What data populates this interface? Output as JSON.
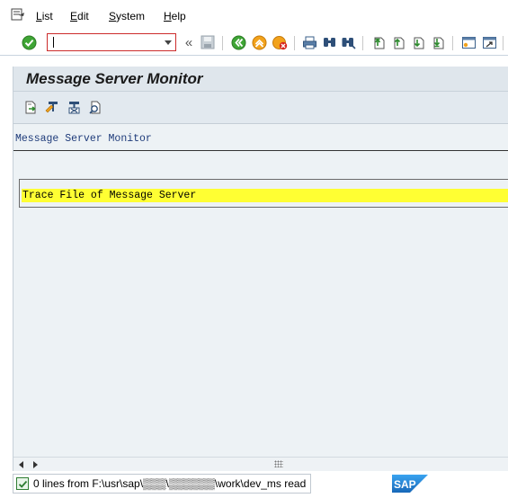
{
  "menubar": {
    "items": [
      {
        "label": "List",
        "key": "L",
        "rest": "ist"
      },
      {
        "label": "Edit",
        "key": "E",
        "rest": "dit"
      },
      {
        "label": "System",
        "key": "S",
        "rest": "ystem"
      },
      {
        "label": "Help",
        "key": "H",
        "rest": "elp"
      }
    ]
  },
  "toolbar": {
    "command_field_value": "",
    "icons": [
      "enter-icon",
      "back-icon",
      "save-icon",
      "back-green-icon",
      "exit-icon",
      "cancel-icon",
      "print-icon",
      "find-icon",
      "find-next-icon",
      "first-page-icon",
      "previous-page-icon",
      "next-page-icon",
      "last-page-icon",
      "create-session-icon",
      "shortcut-icon"
    ]
  },
  "screen": {
    "title": "Message Server Monitor",
    "app_icons": [
      "refresh-icon",
      "edit-icon",
      "delete-icon",
      "display-icon"
    ]
  },
  "list": {
    "heading": "Message Server Monitor",
    "highlighted_line": "Trace File of Message Server"
  },
  "status": {
    "message": "0 lines from F:\\usr\\sap\\▒▒▒\\▒▒▒▒▒▒\\work\\dev_ms read"
  },
  "colors": {
    "highlight": "#ffff33",
    "panel_bg": "#e6edf2",
    "title_bar": "#dfe6ec",
    "command_border": "#cc2b2b",
    "sap_blue": "#1f7fd1"
  }
}
